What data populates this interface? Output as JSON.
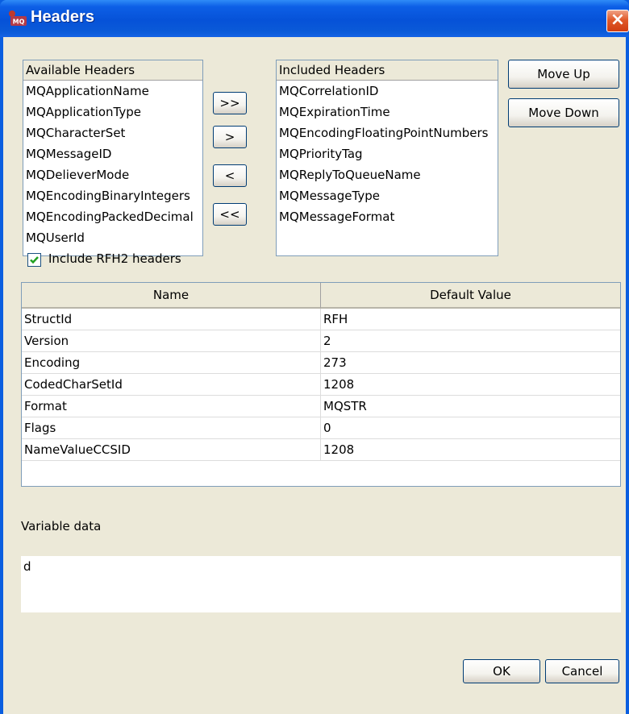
{
  "window": {
    "title": "Headers",
    "icon": "mq-app-icon",
    "close_icon": "close-icon",
    "close_glyph": "×"
  },
  "available_headers": {
    "label": "Available Headers",
    "items": [
      "MQApplicationName",
      "MQApplicationType",
      "MQCharacterSet",
      "MQMessageID",
      "MQDelieverMode",
      "MQEncodingBinaryIntegers",
      "MQEncodingPackedDecimal",
      "MQUserId"
    ]
  },
  "transfer_buttons": {
    "add_all": ">>",
    "add": ">",
    "remove": "<",
    "remove_all": "<<"
  },
  "included_headers": {
    "label": "Included Headers",
    "items": [
      "MQCorrelationID",
      "MQExpirationTime",
      "MQEncodingFloatingPointNumbers",
      "MQPriorityTag",
      "MQReplyToQueueName",
      "MQMessageType",
      "MQMessageFormat"
    ]
  },
  "order_buttons": {
    "move_up": "Move Up",
    "move_down": "Move Down"
  },
  "rfh2": {
    "label": "Include RFH2 headers",
    "checked": true
  },
  "table": {
    "columns": [
      "Name",
      "Default Value"
    ],
    "rows": [
      [
        "StructId",
        "RFH"
      ],
      [
        "Version",
        "2"
      ],
      [
        "Encoding",
        "273"
      ],
      [
        "CodedCharSetId",
        "1208"
      ],
      [
        "Format",
        "MQSTR"
      ],
      [
        "Flags",
        "0"
      ],
      [
        "NameValueCCSID",
        "1208"
      ]
    ]
  },
  "variable_data": {
    "label": "Variable data",
    "value": "d"
  },
  "footer": {
    "ok": "OK",
    "cancel": "Cancel"
  },
  "colors": {
    "title_bar": "#0652d8",
    "client_bg": "#ece9d8",
    "close_button": "#d03e12",
    "checkmark": "#21a121"
  }
}
